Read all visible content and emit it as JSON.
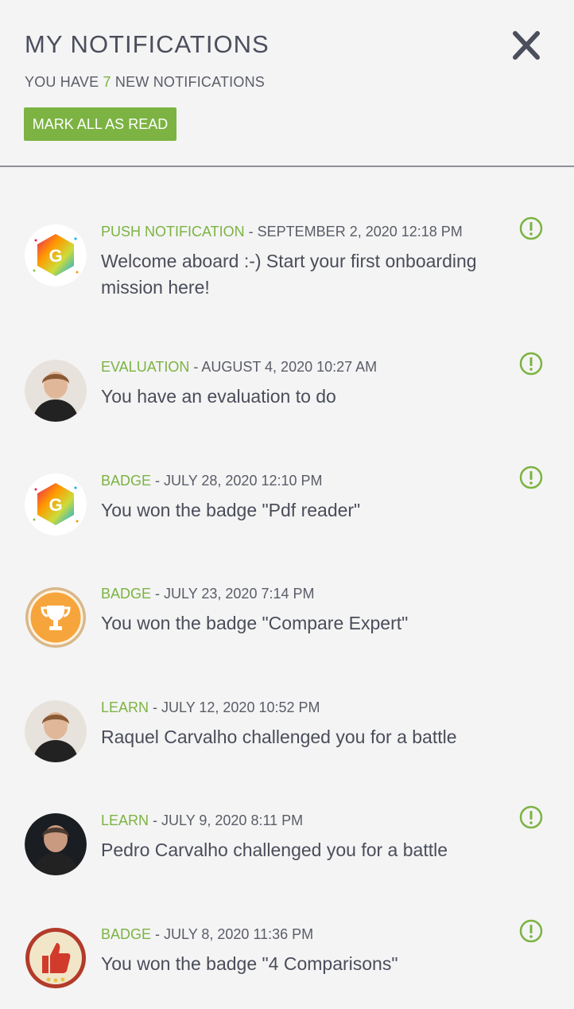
{
  "header": {
    "title": "MY NOTIFICATIONS",
    "subtitle_prefix": "YOU HAVE ",
    "new_count": "7",
    "subtitle_suffix": " NEW NOTIFICATIONS",
    "mark_all_label": "MARK ALL AS READ"
  },
  "colors": {
    "accent": "#7cb342",
    "text": "#4a4d5a",
    "background": "#f4f4f4"
  },
  "notifications": [
    {
      "category": "PUSH NOTIFICATION",
      "date": " - SEPTEMBER 2, 2020 12:18 PM",
      "message": "Welcome aboard :-) Start your first onboarding mission here!",
      "avatar": "logo-g-icon",
      "unread": true
    },
    {
      "category": "EVALUATION",
      "date": " - AUGUST 4, 2020 10:27 AM",
      "message": "You have an evaluation to do",
      "avatar": "user-photo",
      "unread": true
    },
    {
      "category": "BADGE",
      "date": " - JULY 28, 2020 12:10 PM",
      "message": "You won the badge \"Pdf reader\"",
      "avatar": "logo-g-icon",
      "unread": true
    },
    {
      "category": "BADGE",
      "date": " - JULY 23, 2020 7:14 PM",
      "message": "You won the badge \"Compare Expert\"",
      "avatar": "trophy-badge-icon",
      "unread": false
    },
    {
      "category": "LEARN",
      "date": " - JULY 12, 2020 10:52 PM",
      "message": "Raquel Carvalho challenged you for a battle",
      "avatar": "user-photo",
      "unread": false
    },
    {
      "category": "LEARN",
      "date": " - JULY 9, 2020 8:11 PM",
      "message": "Pedro Carvalho challenged you for a battle",
      "avatar": "user-photo",
      "unread": true
    },
    {
      "category": "BADGE",
      "date": " - JULY 8, 2020 11:36 PM",
      "message": "You won the badge \"4 Comparisons\"",
      "avatar": "thumbs-up-badge-icon",
      "unread": true
    }
  ]
}
